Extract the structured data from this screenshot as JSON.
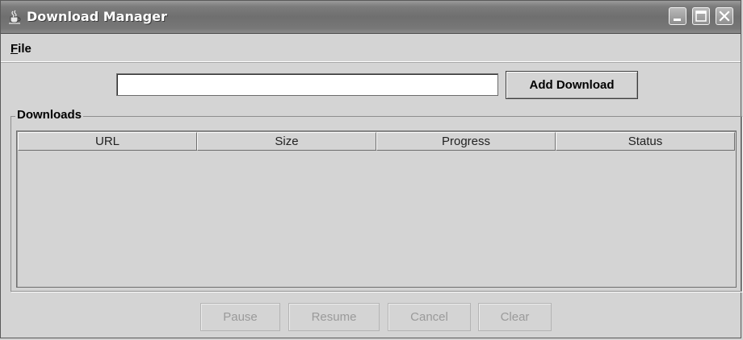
{
  "window": {
    "title": "Download Manager",
    "icon": "java-cup-icon",
    "controls": [
      "minimize-icon",
      "maximize-icon",
      "close-icon"
    ]
  },
  "menu": {
    "items": [
      {
        "label": "File",
        "mnemonic": "F"
      }
    ]
  },
  "toolbar": {
    "url_value": "",
    "add_label": "Add Download"
  },
  "downloads": {
    "group_title": "Downloads",
    "columns": [
      "URL",
      "Size",
      "Progress",
      "Status"
    ],
    "rows": []
  },
  "actions": {
    "pause": "Pause",
    "resume": "Resume",
    "cancel": "Cancel",
    "clear": "Clear",
    "enabled": false
  }
}
